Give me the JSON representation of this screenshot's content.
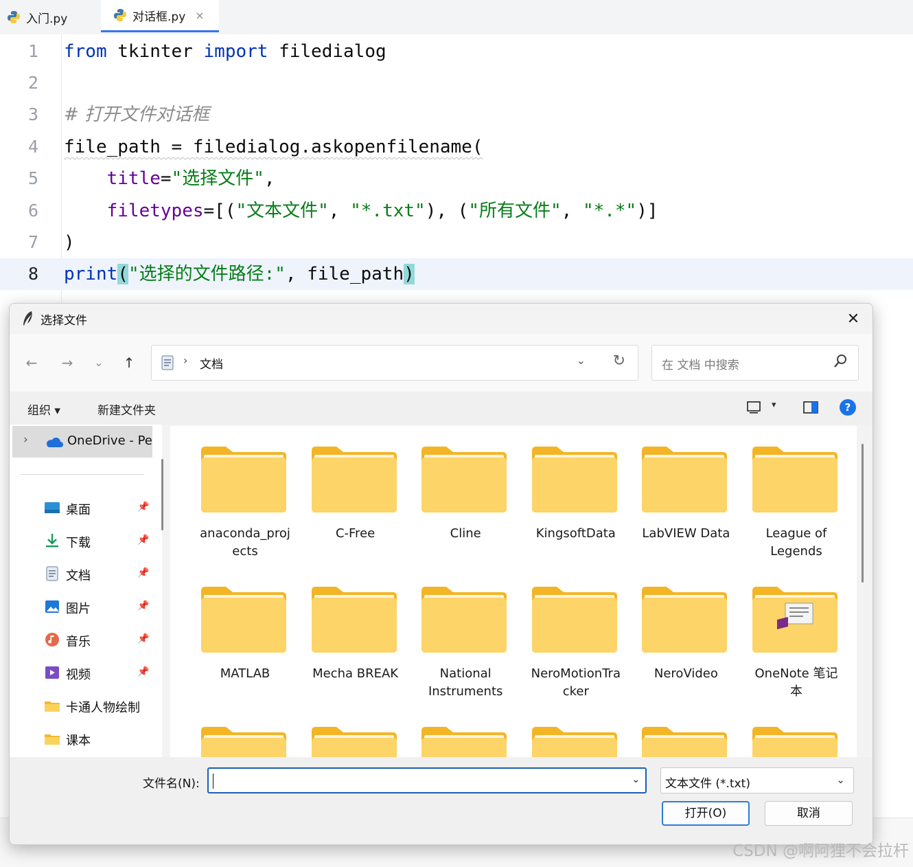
{
  "ide": {
    "tabs": [
      {
        "label": "入门.py",
        "active": false
      },
      {
        "label": "对话框.py",
        "active": true,
        "close": "×"
      }
    ],
    "line_numbers": [
      "1",
      "2",
      "3",
      "4",
      "5",
      "6",
      "7",
      "8"
    ],
    "code": {
      "l1_from": "from",
      "l1_mod": " tkinter ",
      "l1_import": "import",
      "l1_name": " filedialog",
      "l3_comment": "# 打开文件对话框",
      "l4_text": "file_path = filedialog.askopenfilename(",
      "l5_indent": "    ",
      "l5_param": "title",
      "l5_eq": "=",
      "l5_str": "\"选择文件\"",
      "l5_comma": ",",
      "l6_indent": "    ",
      "l6_param": "filetypes",
      "l6_open": "=[(",
      "l6_s1": "\"文本文件\"",
      "l6_c1": ", ",
      "l6_s2": "\"*.txt\"",
      "l6_mid": "), (",
      "l6_s3": "\"所有文件\"",
      "l6_c2": ", ",
      "l6_s4": "\"*.*\"",
      "l6_close": ")]",
      "l7_text": ")",
      "l8_print": "print",
      "l8_open": "(",
      "l8_str": "\"选择的文件路径:\"",
      "l8_rest": ", file_path",
      "l8_close": ")"
    },
    "colors": {
      "keyword": "#0033b3",
      "string": "#067d17",
      "param": "#660099",
      "comment": "#8c8c8c"
    }
  },
  "dialog": {
    "title": "选择文件",
    "close": "✕",
    "nav": {
      "back": "←",
      "forward": "→",
      "recent": "⌄",
      "up": "↑"
    },
    "address": {
      "separator": "›",
      "location": "文档",
      "dropdown": "⌄",
      "refresh": "↻"
    },
    "search_placeholder": "在 文档 中搜索",
    "toolbar": {
      "organize": "组织 ▾",
      "new_folder": "新建文件夹",
      "view_dropdown": "▾",
      "help": "?"
    },
    "sidebar": {
      "onedrive": {
        "chevron": "›",
        "label": "OneDrive - Personal"
      },
      "items": [
        {
          "label": "桌面",
          "icon": "desktop-icon",
          "pinned": true
        },
        {
          "label": "下载",
          "icon": "download-icon",
          "pinned": true
        },
        {
          "label": "文档",
          "icon": "document-icon",
          "pinned": true
        },
        {
          "label": "图片",
          "icon": "pictures-icon",
          "pinned": true
        },
        {
          "label": "音乐",
          "icon": "music-icon",
          "pinned": true
        },
        {
          "label": "视频",
          "icon": "video-icon",
          "pinned": true
        },
        {
          "label": "卡通人物绘制",
          "icon": "folder-icon",
          "pinned": false
        },
        {
          "label": "课本",
          "icon": "folder-icon",
          "pinned": false
        }
      ],
      "pin_glyph": "📌"
    },
    "folders": [
      {
        "label": "anaconda_projects",
        "line1": "anaconda_proj",
        "line2": "ects"
      },
      {
        "label": "C-Free",
        "line1": "C-Free",
        "line2": ""
      },
      {
        "label": "Cline",
        "line1": "Cline",
        "line2": ""
      },
      {
        "label": "KingsoftData",
        "line1": "KingsoftData",
        "line2": ""
      },
      {
        "label": "LabVIEW Data",
        "line1": "LabVIEW Data",
        "line2": ""
      },
      {
        "label": "League of Legends",
        "line1": "League of",
        "line2": "Legends"
      },
      {
        "label": "MATLAB",
        "line1": "MATLAB",
        "line2": ""
      },
      {
        "label": "Mecha BREAK",
        "line1": "Mecha BREAK",
        "line2": ""
      },
      {
        "label": "National Instruments",
        "line1": "National",
        "line2": "Instruments"
      },
      {
        "label": "NeroMotionTracker",
        "line1": "NeroMotionTra",
        "line2": "cker"
      },
      {
        "label": "NeroVideo",
        "line1": "NeroVideo",
        "line2": ""
      },
      {
        "label": "OneNote 笔记本",
        "line1": "OneNote 笔记",
        "line2": "本"
      }
    ],
    "filename_label": "文件名(N):",
    "filename_value": "",
    "filetype_selected": "文本文件 (*.txt)",
    "dropdown_glyph": "⌄",
    "open_button": "打开(O)",
    "cancel_button": "取消"
  },
  "watermark": "CSDN @啊阿狸不会拉杆"
}
